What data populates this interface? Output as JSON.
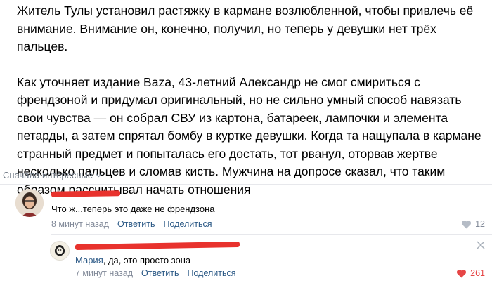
{
  "post": {
    "paragraph1": "Житель Тулы установил растяжку в кармане возлюбленной, чтобы привлечь её внимание. Внимание он, конечно, получил, но теперь у девушки нет трёх пальцев.",
    "paragraph2": "Как уточняет издание Baza, 43-летний Александр не смог смириться с френдзоной и придумал оригинальный, но не сильно умный способ навязать свои чувства — он собрал СВУ из картона, батареек, лампочки и элемента петарды, а затем спрятал бомбу в куртке девушки. Когда та нащупала в кармане странный предмет и попыталась его достать, тот рванул, оторвав жертве несколько пальцев и сломав кисть. Мужчина на допросе сказал, что таким образом рассчитывал начать отношения"
  },
  "comments": {
    "sort_label": "Сначала интересные",
    "items": [
      {
        "text": "Что ж...теперь это даже не френдзона",
        "time": "8 минут назад",
        "reply_label": "Ответить",
        "share_label": "Поделиться",
        "likes": "12",
        "like_color": "#b5bcc6"
      },
      {
        "author": "Мария",
        "text": ", да, это просто зона",
        "time": "7 минут назад",
        "reply_label": "Ответить",
        "share_label": "Поделиться",
        "likes": "261",
        "like_color": "#e64646"
      }
    ]
  },
  "colors": {
    "link": "#2a5885",
    "meta": "#828a99",
    "redaction": "#e8322d"
  }
}
